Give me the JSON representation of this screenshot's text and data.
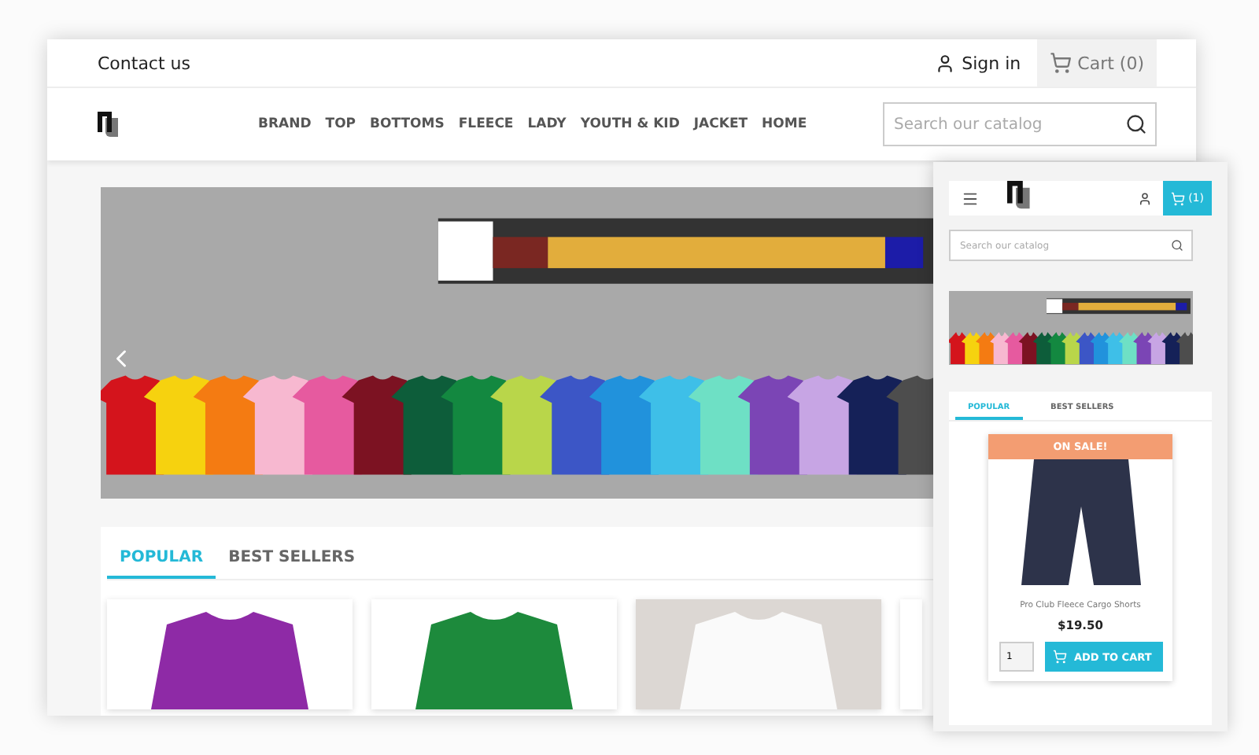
{
  "desktop": {
    "top_bar": {
      "contact": "Contact us",
      "sign_in": "Sign in",
      "cart": "Cart (0)"
    },
    "nav": [
      "BRAND",
      "TOP",
      "BOTTOMS",
      "FLEECE",
      "LADY",
      "YOUTH & KID",
      "JACKET",
      "HOME"
    ],
    "search": {
      "placeholder": "Search our catalog"
    },
    "tabs": [
      {
        "label": "POPULAR",
        "selected": true
      },
      {
        "label": "BEST SELLERS",
        "selected": false
      }
    ],
    "products": [
      {
        "kind": "purple"
      },
      {
        "kind": "green"
      },
      {
        "kind": "white"
      },
      {
        "kind": "cut"
      }
    ]
  },
  "mobile": {
    "cart": "(1)",
    "search": {
      "placeholder": "Search our catalog"
    },
    "tabs": [
      {
        "label": "POPULAR",
        "selected": true
      },
      {
        "label": "BEST SELLERS",
        "selected": false
      }
    ],
    "product": {
      "badge": "ON SALE!",
      "name": "Pro Club Fleece Cargo Shorts",
      "price": "$19.50",
      "quantity": "1",
      "button": "ADD TO CART"
    }
  }
}
